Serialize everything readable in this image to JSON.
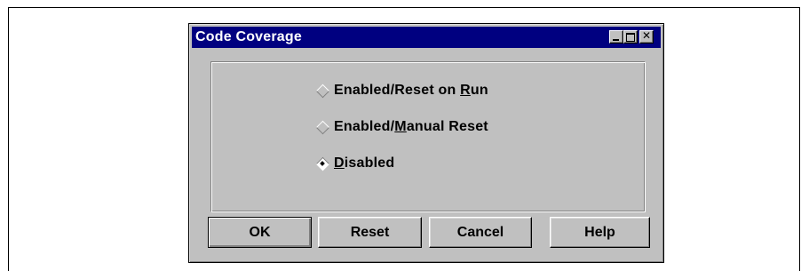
{
  "window": {
    "title": "Code Coverage",
    "controls": {
      "minimize_icon": "minimize-icon",
      "maximize_icon": "maximize-icon",
      "close_glyph": "✕"
    }
  },
  "coverage_mode": {
    "options": [
      {
        "pre": "Enabled/Reset on ",
        "mnemonic": "R",
        "post": "un",
        "selected": false
      },
      {
        "pre": "Enabled/",
        "mnemonic": "M",
        "post": "anual Reset",
        "selected": false
      },
      {
        "pre": "",
        "mnemonic": "D",
        "post": "isabled",
        "selected": true
      }
    ]
  },
  "buttons": {
    "ok": "OK",
    "reset": "Reset",
    "cancel": "Cancel",
    "help": "Help"
  },
  "colors": {
    "title_bar": "#000080",
    "face": "#c0c0c0"
  }
}
